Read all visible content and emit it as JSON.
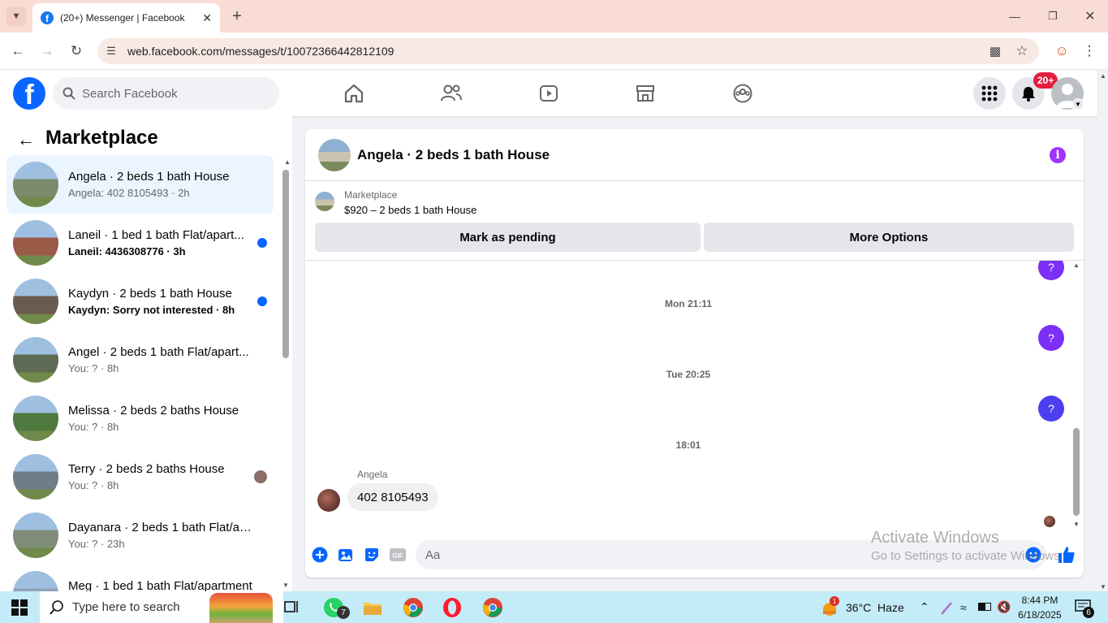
{
  "browser": {
    "tab_title": "(20+) Messenger | Facebook",
    "url": "web.facebook.com/messages/t/10072366442812109"
  },
  "header": {
    "search_placeholder": "Search Facebook",
    "notification_badge": "20+"
  },
  "sidebar": {
    "title": "Marketplace",
    "conversations": [
      {
        "title": "Angela · 2 beds 1 bath House",
        "snippet": "Angela: 402 8105493 · 2h",
        "unread": false,
        "active": true,
        "color": "#7a8a6a"
      },
      {
        "title": "Laneil · 1 bed 1 bath Flat/apart...",
        "snippet": "Laneil: 4436308776 · 3h",
        "unread": true,
        "active": false,
        "color": "#9a5a48"
      },
      {
        "title": "Kaydyn · 2 beds 1 bath House",
        "snippet": "Kaydyn: Sorry not interested · 8h",
        "unread": true,
        "active": false,
        "color": "#6b5a4e"
      },
      {
        "title": "Angel · 2 beds 1 bath Flat/apart...",
        "snippet": "You: ? · 8h",
        "unread": false,
        "active": false,
        "color": "#5d6b55"
      },
      {
        "title": "Melissa · 2 beds 2 baths House",
        "snippet": "You: ? · 8h",
        "unread": false,
        "active": false,
        "color": "#4f7a3f"
      },
      {
        "title": "Terry · 2 beds 2 baths House",
        "snippet": "You: ? · 8h",
        "unread": false,
        "active": false,
        "color": "#6e7d88"
      },
      {
        "title": "Dayanara · 2 beds 1 bath Flat/ap...",
        "snippet": "You: ? · 23h",
        "unread": false,
        "active": false,
        "color": "#7f8c7a"
      },
      {
        "title": "Meg · 1 bed 1 bath Flat/apartment",
        "snippet": "",
        "unread": false,
        "active": false,
        "color": "#8fa2b8"
      }
    ]
  },
  "chat": {
    "title": "Angela · 2 beds 1 bath House",
    "listing_label": "Marketplace",
    "listing_detail": "$920 – 2 beds 1 bath House",
    "mark_pending": "Mark as pending",
    "more_options": "More Options",
    "timestamps": [
      "Mon 21:11",
      "Tue 20:25",
      "18:01"
    ],
    "outgoing_bubble": "?",
    "sender_name": "Angela",
    "incoming_message": "402 8105493",
    "composer_placeholder": "Aa"
  },
  "watermark": {
    "line1": "Activate Windows",
    "line2": "Go to Settings to activate Windows."
  },
  "taskbar": {
    "search_placeholder": "Type here to search",
    "whatsapp_badge": "7",
    "weather": "36°C  Haze",
    "time": "8:44 PM",
    "date": "6/18/2025",
    "notif_count": "6"
  }
}
